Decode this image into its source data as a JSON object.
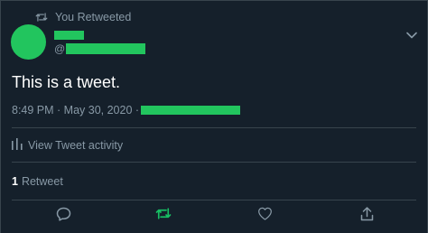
{
  "retweet_context": {
    "icon": "retweet-icon",
    "label": "You Retweeted"
  },
  "author": {
    "avatar_color": "#22c55e",
    "handle_prefix": "@"
  },
  "tweet": {
    "text": "This is a tweet.",
    "timestamp": "8:49 PM · May 30, 2020 ·"
  },
  "activity": {
    "icon": "analytics-icon",
    "label": "View Tweet activity"
  },
  "stats": {
    "retweet_count": "1",
    "retweet_label": "Retweet"
  },
  "actions": {
    "reply_icon": "reply-icon",
    "retweet_icon": "retweet-icon",
    "like_icon": "heart-icon",
    "share_icon": "share-icon",
    "retweet_active_color": "#17bf63"
  },
  "colors": {
    "background": "#15202b",
    "secondary_text": "#8899a6",
    "divider": "#38444d",
    "redaction": "#22c55e"
  }
}
